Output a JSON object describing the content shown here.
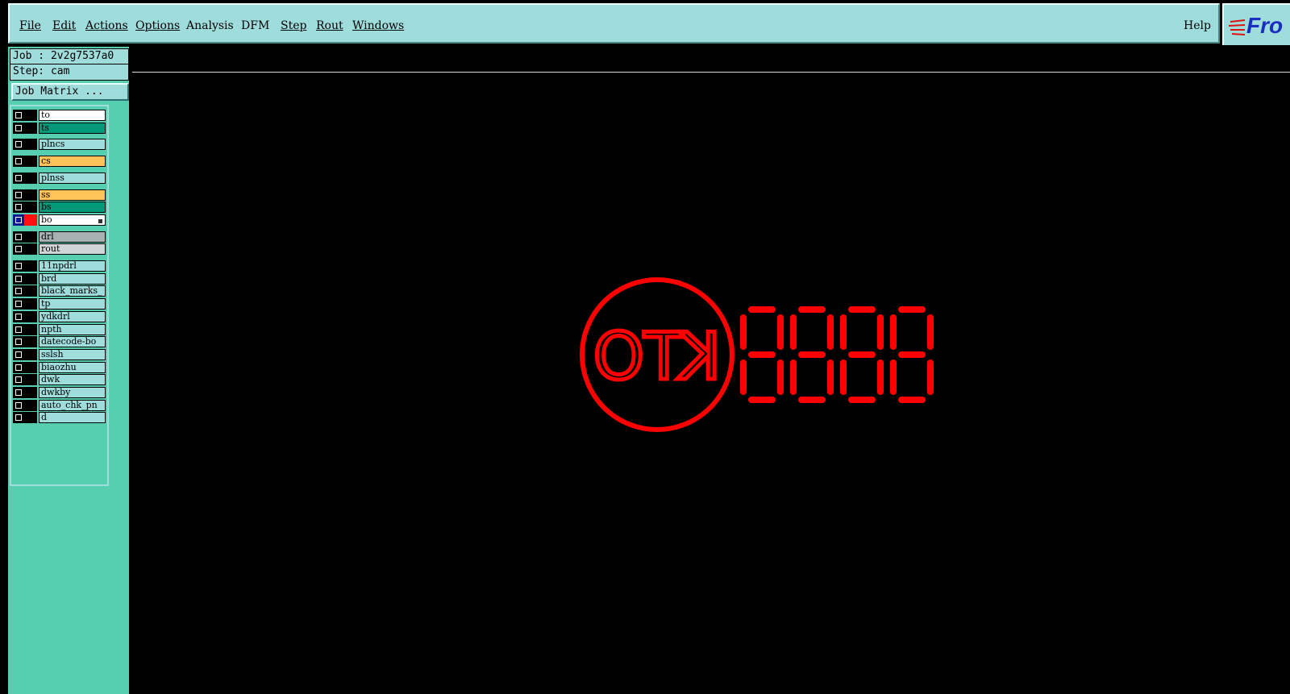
{
  "menubar": {
    "items": [
      "File",
      "Edit",
      "Actions",
      "Options",
      "Analysis",
      "DFM",
      "Step",
      "Rout",
      "Windows"
    ],
    "help": "Help",
    "logo": "Fro"
  },
  "job": {
    "job_line": "Job : 2v2g7537a0",
    "step_line": "Step: cam",
    "matrix_button": "Job Matrix ..."
  },
  "layers": [
    {
      "name": "to",
      "color": "white"
    },
    {
      "name": "ts",
      "color": "green"
    },
    {
      "name": "plncs",
      "color": "cyan"
    },
    {
      "name": "cs",
      "color": "orange"
    },
    {
      "name": "plnss",
      "color": "cyan"
    },
    {
      "name": "ss",
      "color": "orange"
    },
    {
      "name": "bs",
      "color": "green"
    },
    {
      "name": "bo",
      "color": "white",
      "active": true
    },
    {
      "name": "drl",
      "color": "grey"
    },
    {
      "name": "rout",
      "color": "lgrey"
    },
    {
      "name": "11npdrl",
      "color": "cyan"
    },
    {
      "name": "brd",
      "color": "cyan"
    },
    {
      "name": "black_marks_",
      "color": "cyan"
    },
    {
      "name": "tp",
      "color": "cyan"
    },
    {
      "name": "ydkdrl",
      "color": "cyan"
    },
    {
      "name": "npth",
      "color": "cyan"
    },
    {
      "name": "datecode-bo",
      "color": "cyan"
    },
    {
      "name": "sslsh",
      "color": "cyan"
    },
    {
      "name": "biaozhu",
      "color": "cyan"
    },
    {
      "name": "dwk",
      "color": "cyan"
    },
    {
      "name": "dwkby",
      "color": "cyan"
    },
    {
      "name": "auto_chk_pn",
      "color": "cyan"
    },
    {
      "name": "d",
      "color": "cyan"
    }
  ],
  "canvas": {
    "mark_text": "KTO",
    "digits": "8888",
    "feature_color": "#ff0000"
  }
}
